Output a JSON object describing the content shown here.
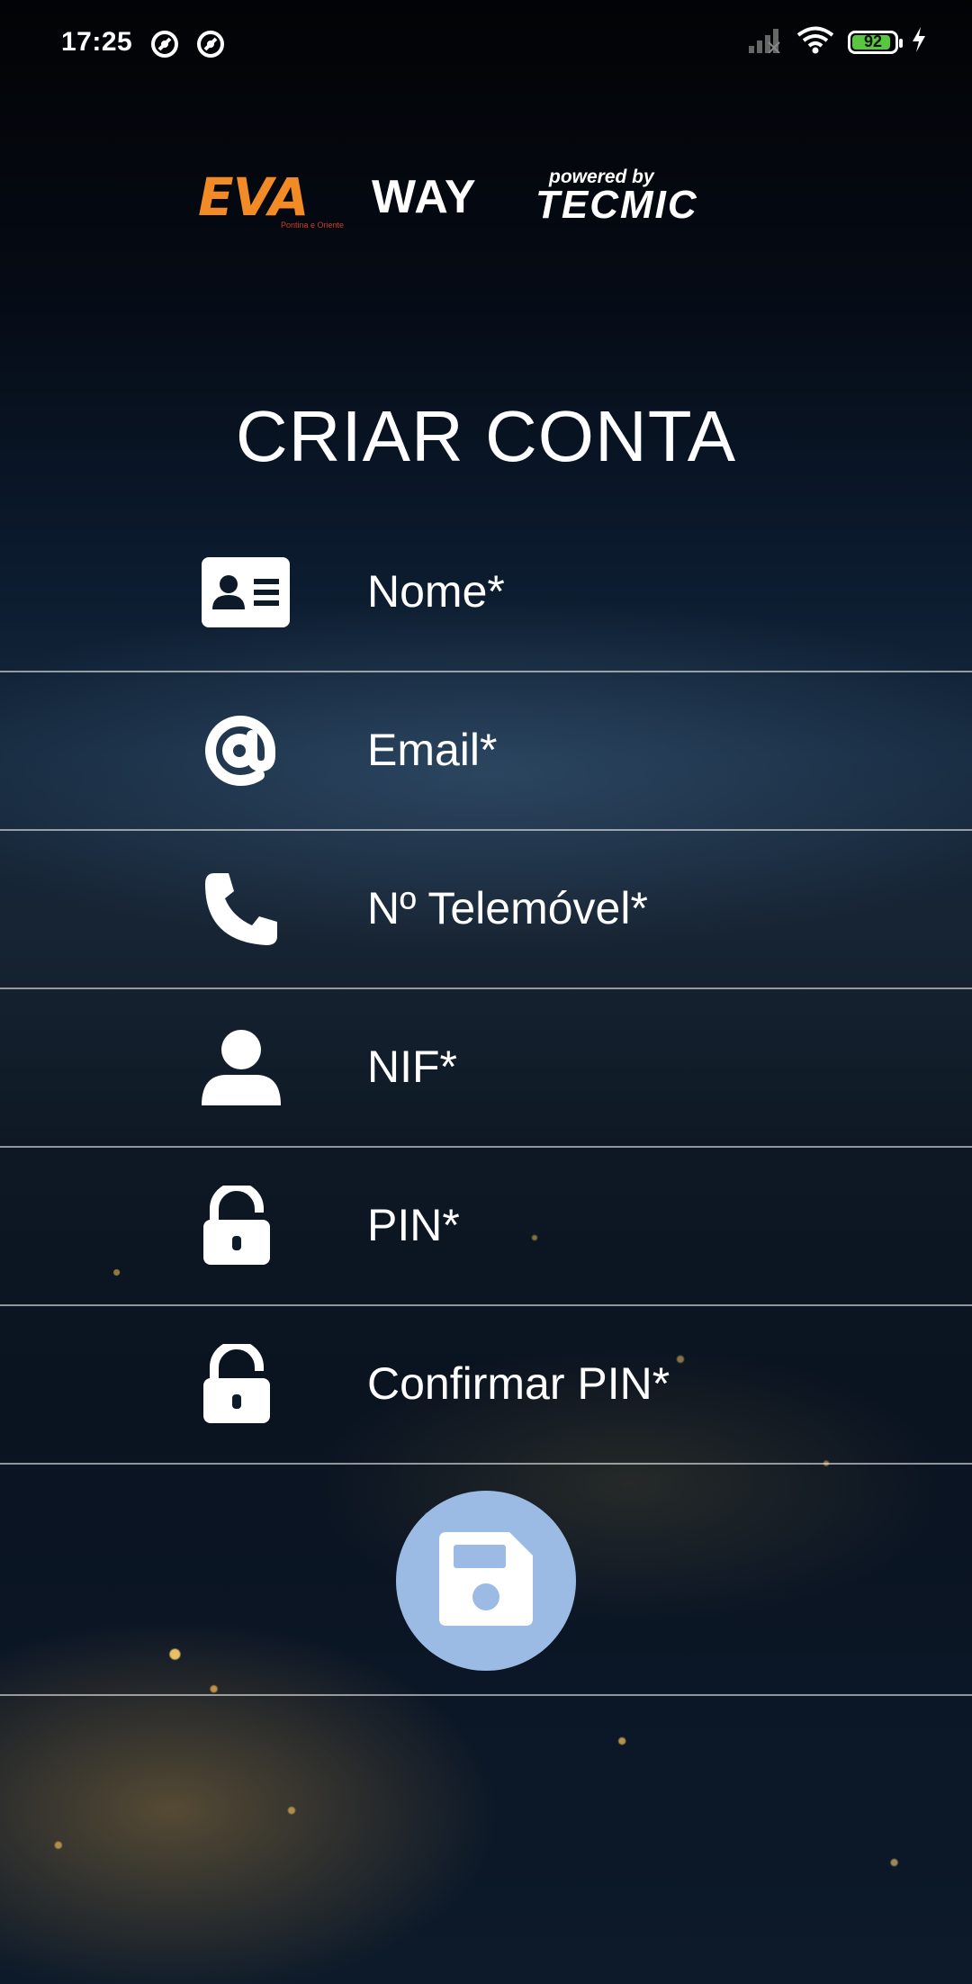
{
  "status_bar": {
    "time": "17:25",
    "battery_level": "92"
  },
  "logo": {
    "eva": "EVA",
    "eva_sub": "Pontina e Oriente",
    "way": "WAY",
    "powered_by": "powered by",
    "tecmic": "TECMIC"
  },
  "page": {
    "title": "CRIAR CONTA"
  },
  "form": {
    "fields": [
      {
        "label": "Nome*",
        "icon": "id-card-icon"
      },
      {
        "label": "Email*",
        "icon": "at-sign-icon"
      },
      {
        "label": "Nº Telemóvel*",
        "icon": "phone-icon"
      },
      {
        "label": "NIF*",
        "icon": "user-icon"
      },
      {
        "label": "PIN*",
        "icon": "unlock-icon"
      },
      {
        "label": "Confirmar PIN*",
        "icon": "unlock-icon"
      }
    ],
    "save_icon": "floppy-disk-icon"
  },
  "colors": {
    "save_button": "#9bbbe4",
    "battery_fill": "#59c640",
    "logo_eva": "#f28a25"
  }
}
